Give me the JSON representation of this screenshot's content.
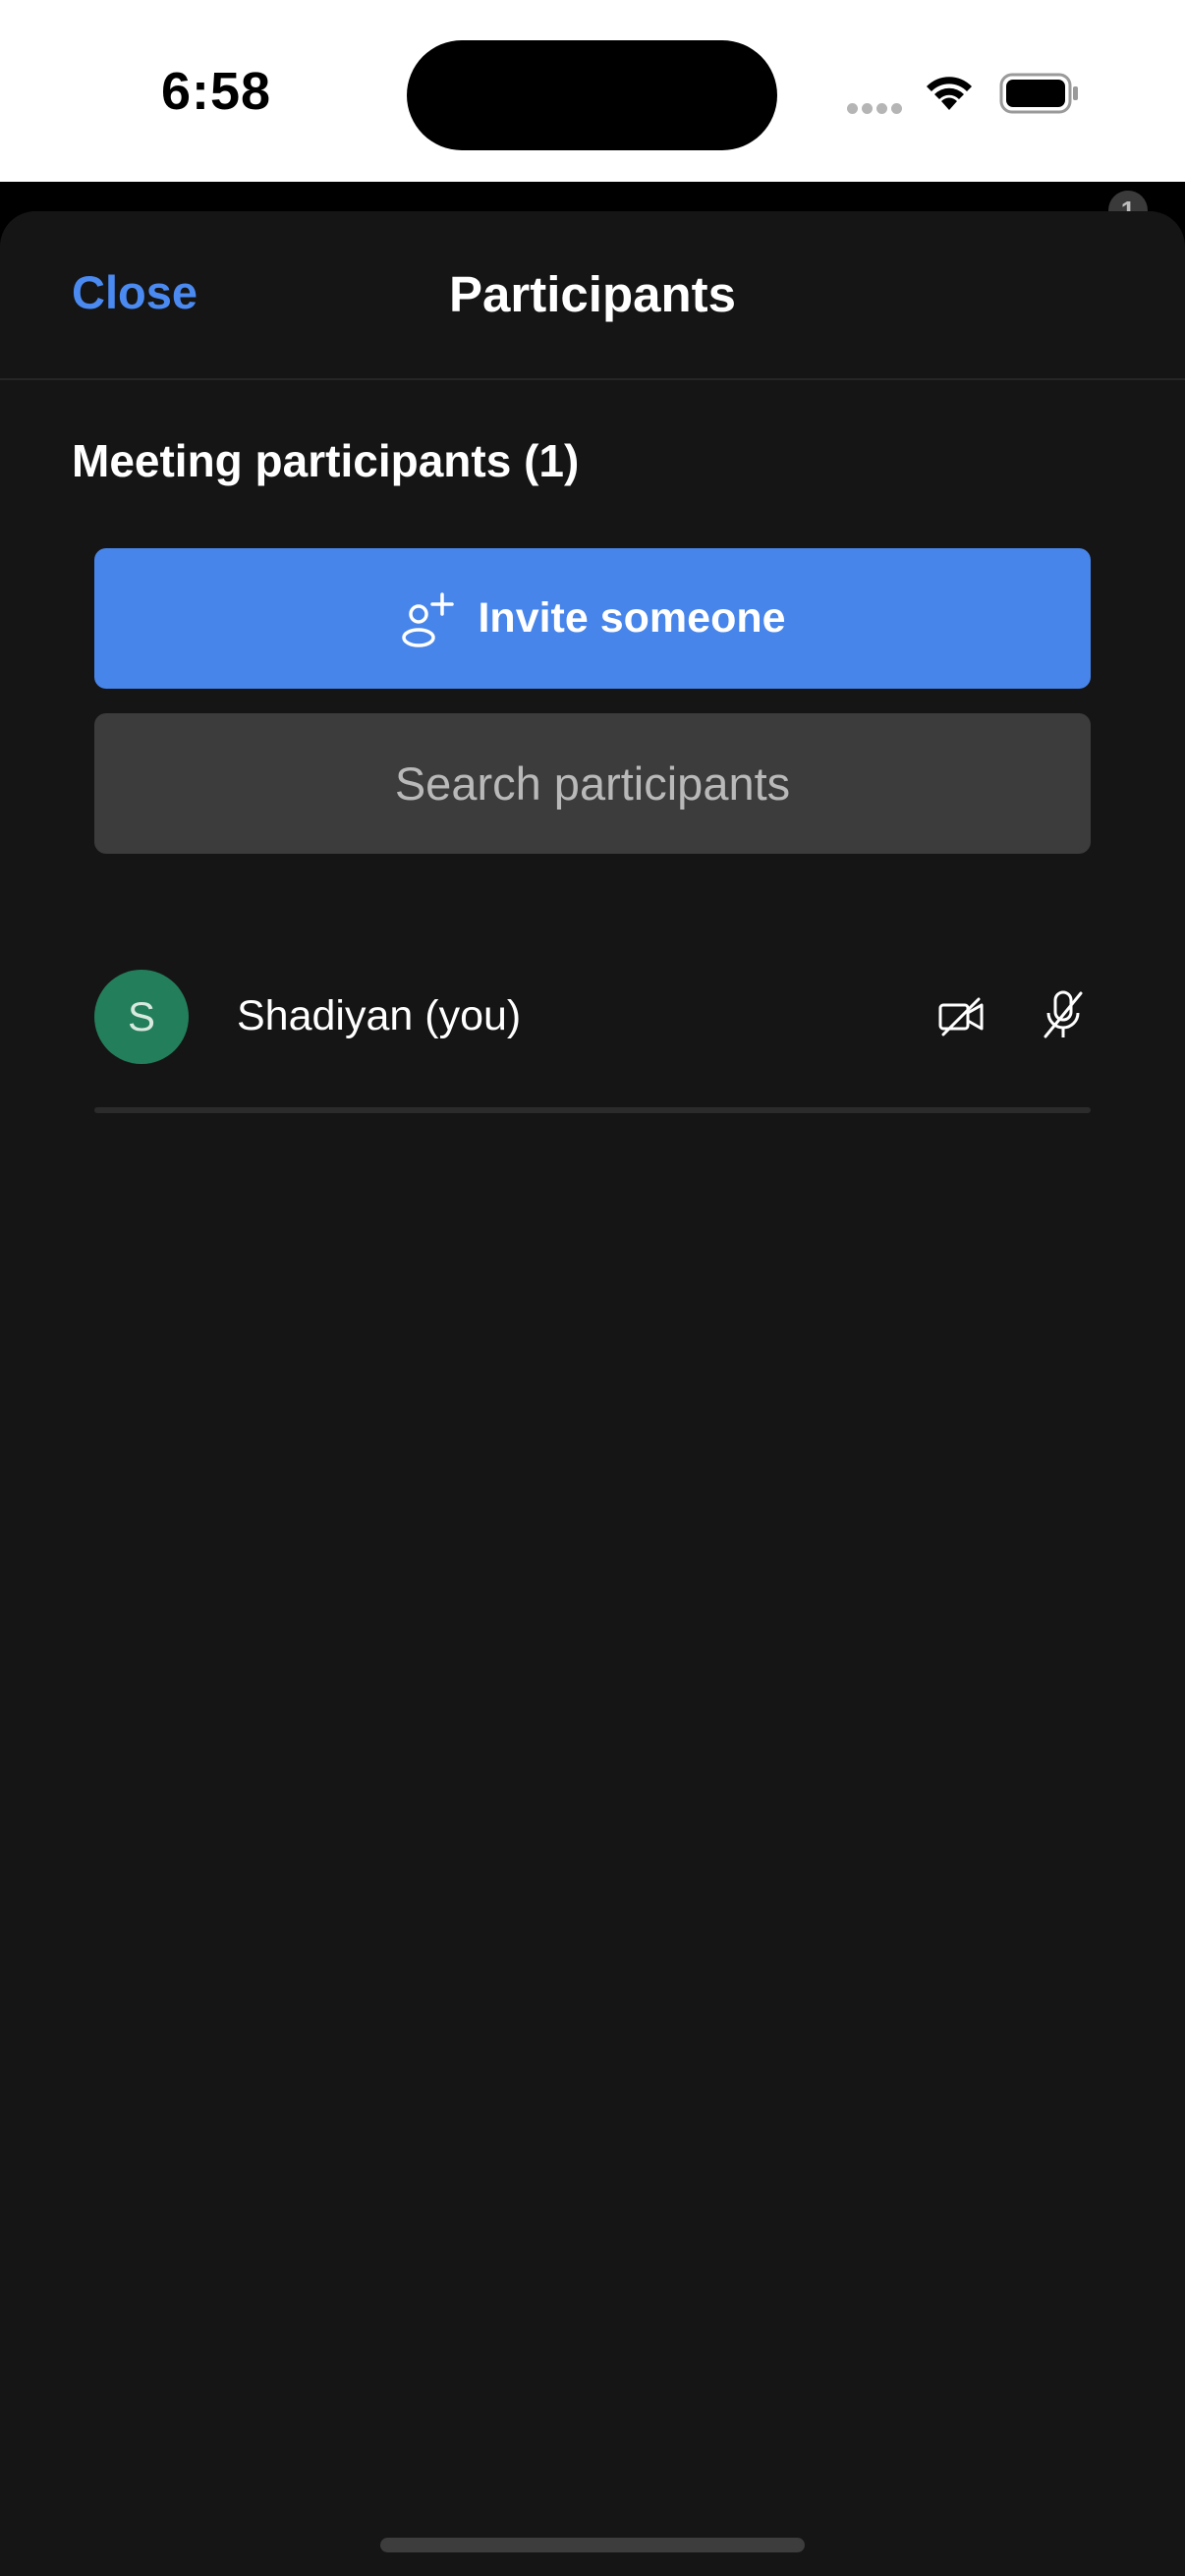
{
  "status_bar": {
    "time": "6:58"
  },
  "backdrop": {
    "badge_count": "1"
  },
  "sheet": {
    "close_label": "Close",
    "title": "Participants",
    "section_heading": "Meeting participants (1)",
    "invite_label": "Invite someone",
    "search_placeholder": "Search participants",
    "search_value": ""
  },
  "participants": [
    {
      "initial": "S",
      "name": "Shadiyan (you)",
      "avatar_color": "#237e5b",
      "camera_icon": "camera-off-icon",
      "mic_icon": "mic-off-icon"
    }
  ],
  "colors": {
    "accent": "#4a8af1",
    "invite_button": "#4785ea",
    "sheet_background": "#151515",
    "search_background": "#3c3c3c"
  }
}
